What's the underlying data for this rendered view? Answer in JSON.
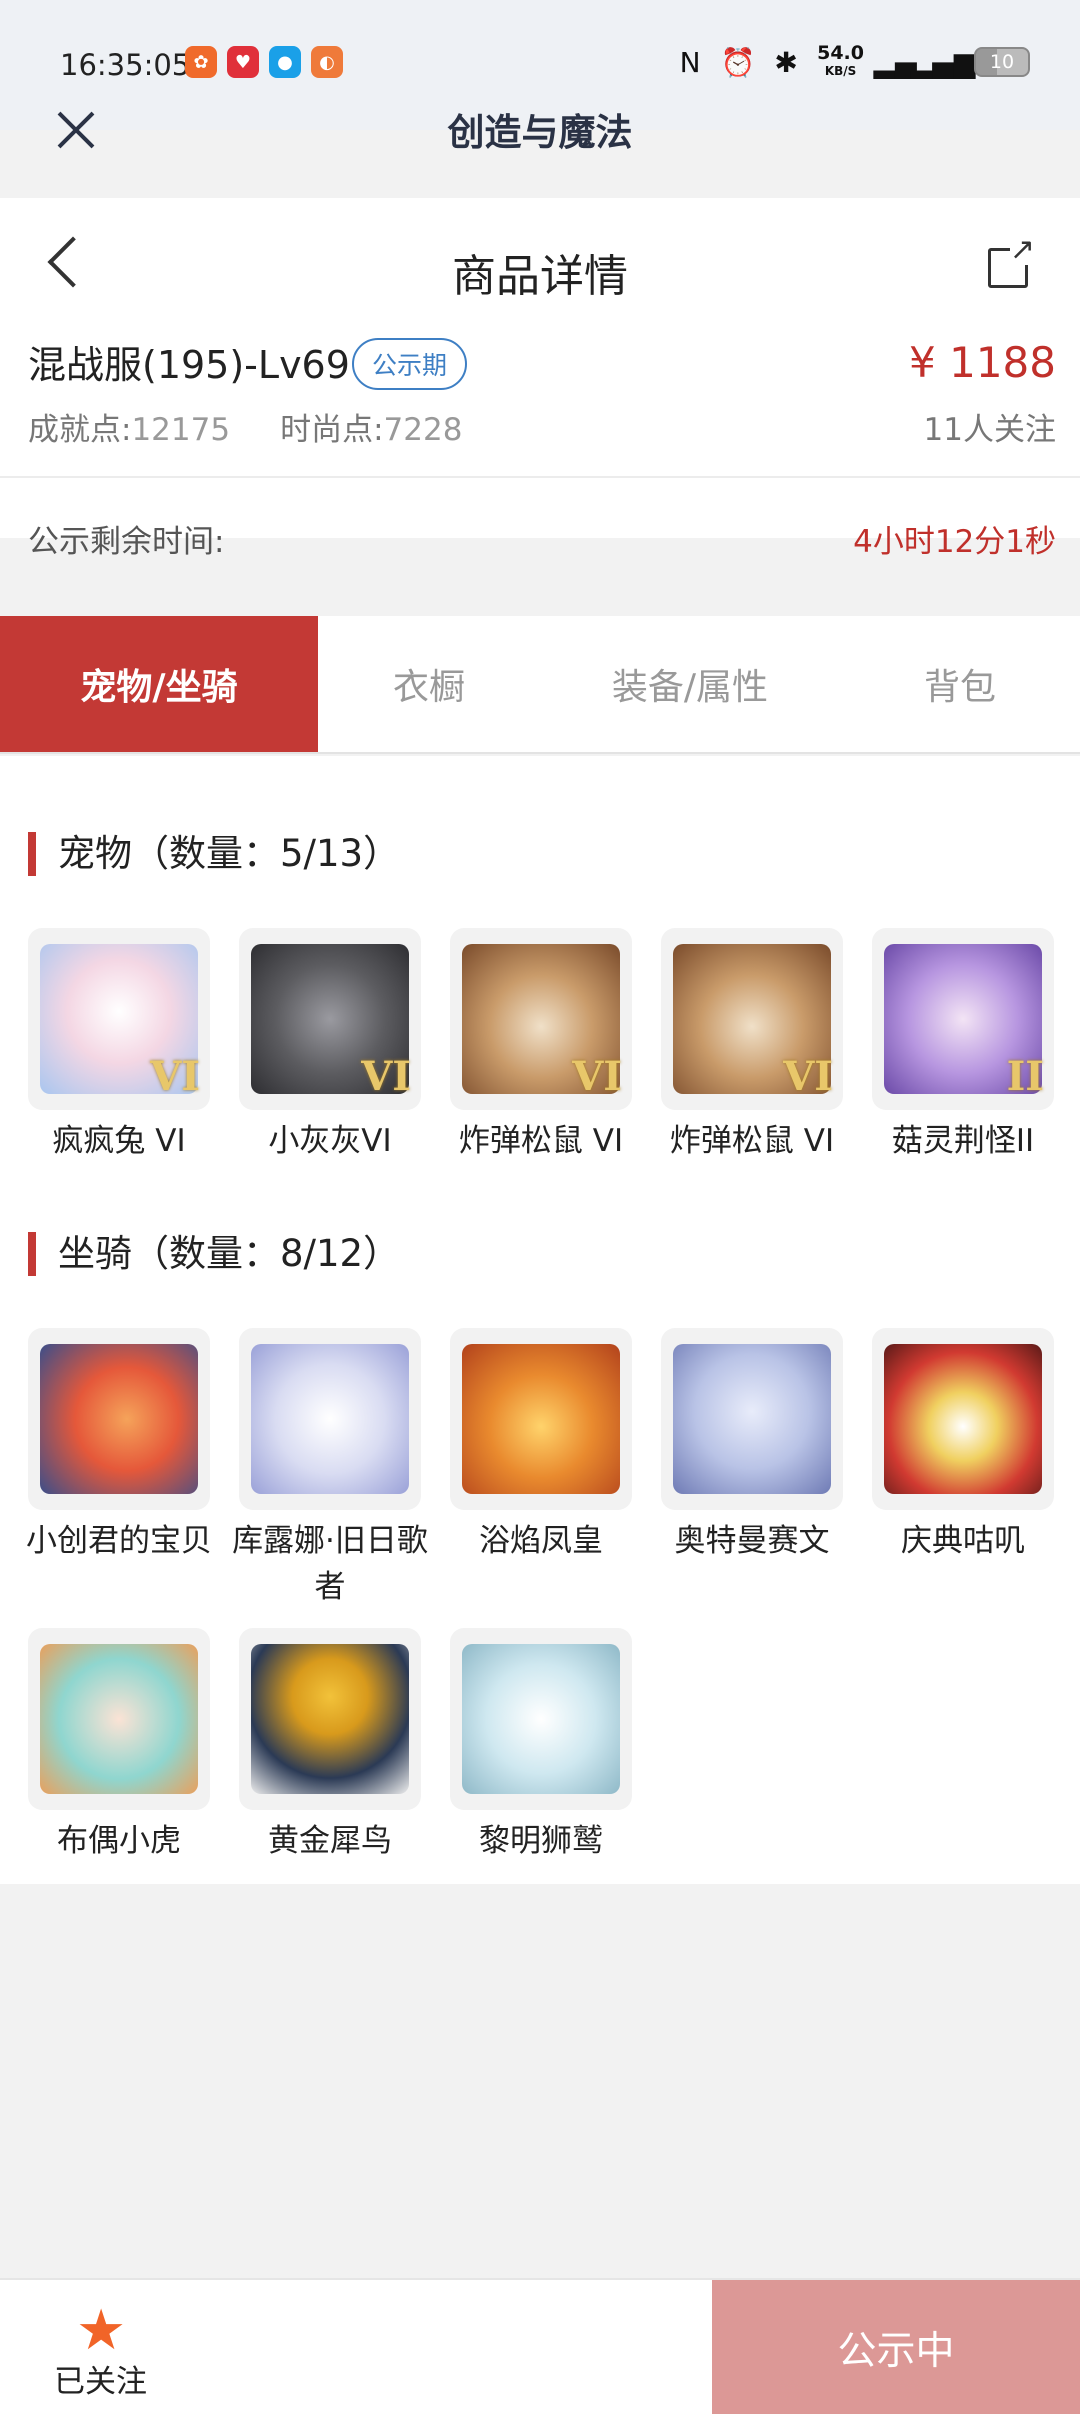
{
  "status_bar": {
    "time": "16:35:05",
    "apps": [
      "app-1",
      "app-2",
      "app-3",
      "app-4"
    ],
    "speed": "54.0",
    "speed_unit": "KB/S",
    "battery": "10"
  },
  "app": {
    "title": "创造与魔法"
  },
  "header": {
    "page_title": "商品详情",
    "item_name": "混战服(195)-Lv69",
    "badge": "公示期",
    "price": "¥ 1188",
    "achievement_label": "成就点:",
    "achievement_value": "12175",
    "fashion_label": "时尚点:",
    "fashion_value": "7228",
    "followers": "11人关注",
    "remaining_label": "公示剩余时间:",
    "remaining_value": "4小时12分1秒"
  },
  "tabs": [
    {
      "label": "宠物/坐骑",
      "active": true
    },
    {
      "label": "衣橱",
      "active": false
    },
    {
      "label": "装备/属性",
      "active": false
    },
    {
      "label": "背包",
      "active": false
    }
  ],
  "pets": {
    "title": "宠物（数量：5/13）",
    "items": [
      {
        "name": "疯疯兔 VI",
        "level": "VI",
        "color": "#f4d7e4"
      },
      {
        "name": "小灰灰VI",
        "level": "VI",
        "color": "#5c5c60"
      },
      {
        "name": "炸弹松鼠 VI",
        "level": "VI",
        "color": "#c99b6a"
      },
      {
        "name": "炸弹松鼠 VI",
        "level": "VI",
        "color": "#c99b6a"
      },
      {
        "name": "菇灵荆怪II",
        "level": "II",
        "color": "#b796e0"
      }
    ]
  },
  "mounts": {
    "title": "坐骑（数量：8/12）",
    "items": [
      {
        "name": "小创君的宝贝",
        "color": "#e5583a"
      },
      {
        "name": "库露娜·旧日歌者",
        "color": "#d9dcf2"
      },
      {
        "name": "浴焰凤皇",
        "color": "#e98a2e"
      },
      {
        "name": "奥特曼赛文",
        "color": "#b9c3e6"
      },
      {
        "name": "庆典咕叽",
        "color": "#d13a31"
      },
      {
        "name": "布偶小虎",
        "color": "#8fd6cf"
      },
      {
        "name": "黄金犀鸟",
        "color": "#2b3a55"
      },
      {
        "name": "黎明狮鹫",
        "color": "#cfe8f0"
      }
    ]
  },
  "bottom": {
    "follow_label": "已关注",
    "status_button": "公示中"
  }
}
